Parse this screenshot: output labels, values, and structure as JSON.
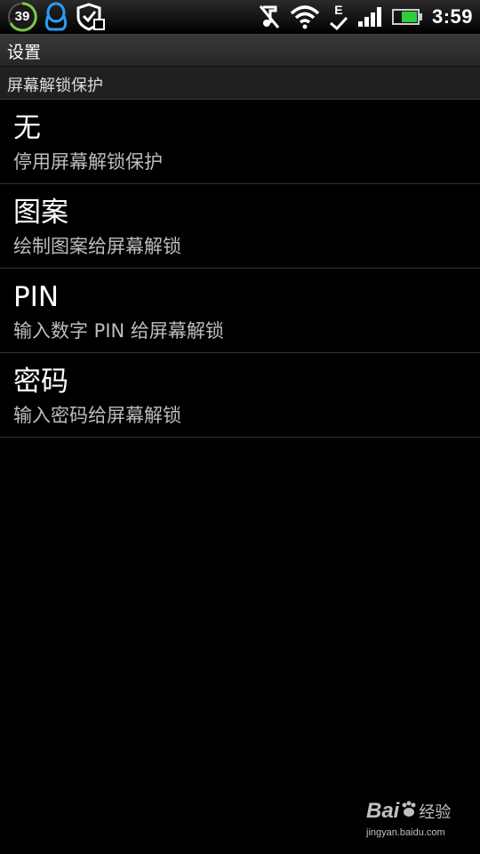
{
  "status_bar": {
    "notification_count": "39",
    "time": "3:59",
    "network_type": "E",
    "icons": [
      "notification-count-icon",
      "qq-penguin-icon",
      "security-shield-icon",
      "mute-icon",
      "wifi-icon",
      "edge-data-icon",
      "signal-icon",
      "battery-icon"
    ],
    "battery_color": "#2ecc40"
  },
  "title_bar": {
    "title": "设置"
  },
  "section": {
    "title": "屏幕解锁保护"
  },
  "options": [
    {
      "title": "无",
      "summary": "停用屏幕解锁保护"
    },
    {
      "title": "图案",
      "summary": "绘制图案给屏幕解锁"
    },
    {
      "title": "PIN",
      "summary": "输入数字 PIN 给屏幕解锁"
    },
    {
      "title": "密码",
      "summary": "输入密码给屏幕解锁"
    }
  ],
  "watermark": {
    "brand_left": "Bai",
    "brand_right": "经验",
    "url": "jingyan.baidu.com"
  }
}
